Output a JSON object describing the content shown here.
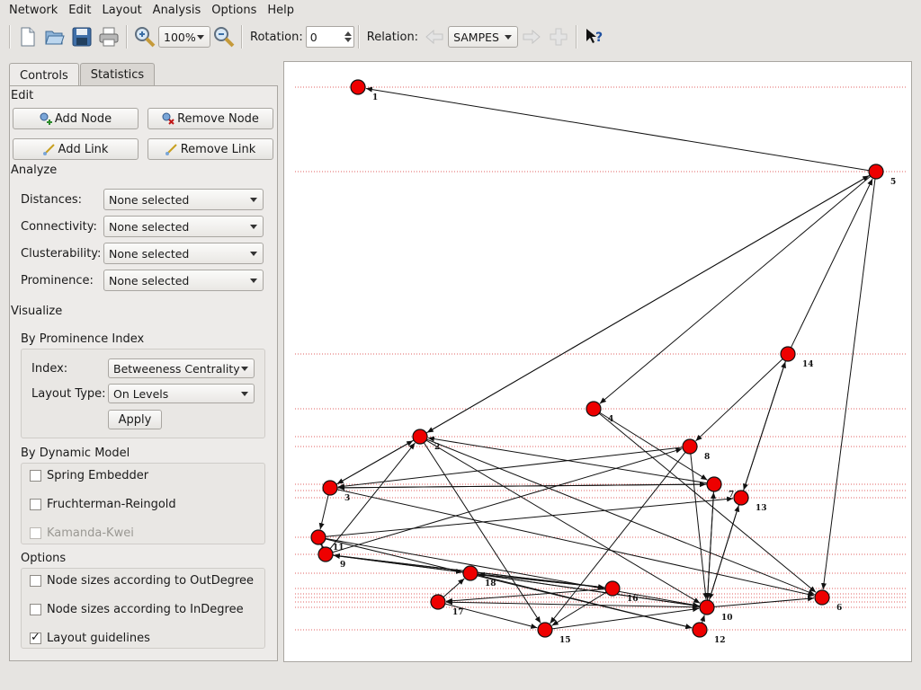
{
  "menubar": {
    "items": [
      "Network",
      "Edit",
      "Layout",
      "Analysis",
      "Options",
      "Help"
    ]
  },
  "toolbar": {
    "zoom": "100%",
    "rotation_label": "Rotation:",
    "rotation_value": "0",
    "relation_label": "Relation:",
    "relation_value": "SAMPES",
    "icons": [
      "new-file-icon",
      "open-folder-icon",
      "save-icon",
      "print-icon",
      "zoom-in-icon",
      "zoom-out-icon",
      "previous-relation-icon",
      "next-relation-icon",
      "add-relation-icon",
      "whats-this-help-icon"
    ]
  },
  "tabs": [
    "Controls",
    "Statistics"
  ],
  "edit": {
    "title": "Edit",
    "add_node": "Add Node",
    "remove_node": "Remove Node",
    "add_link": "Add Link",
    "remove_link": "Remove Link"
  },
  "analyze": {
    "title": "Analyze",
    "rows": [
      {
        "label": "Distances:",
        "value": "None selected"
      },
      {
        "label": "Connectivity:",
        "value": "None selected"
      },
      {
        "label": "Clusterability:",
        "value": "None selected"
      },
      {
        "label": "Prominence:",
        "value": "None selected"
      }
    ]
  },
  "visualize": {
    "title": "Visualize",
    "prominence": {
      "title": "By Prominence Index",
      "index_label": "Index:",
      "index_value": "Betweeness Centrality",
      "layout_label": "Layout Type:",
      "layout_value": "On Levels",
      "apply": "Apply"
    },
    "dynamic": {
      "title": "By Dynamic Model",
      "spring": "Spring Embedder",
      "fruchterman": "Fruchterman-Reingold",
      "kamada": "Kamanda-Kwei"
    },
    "options": {
      "title": "Options",
      "outdegree": "Node sizes according to OutDegree",
      "indegree": "Node sizes according to InDegree",
      "guidelines": "Layout guidelines",
      "outdegree_checked": false,
      "indegree_checked": false,
      "guidelines_checked": true
    }
  },
  "graph": {
    "node_color": "#ee0000",
    "guideline_color": "#e06060",
    "nodes": [
      {
        "id": "1"
      },
      {
        "id": "2"
      },
      {
        "id": "3"
      },
      {
        "id": "4"
      },
      {
        "id": "5"
      },
      {
        "id": "6"
      },
      {
        "id": "7"
      },
      {
        "id": "8"
      },
      {
        "id": "9"
      },
      {
        "id": "10"
      },
      {
        "id": "11"
      },
      {
        "id": "12"
      },
      {
        "id": "13"
      },
      {
        "id": "14"
      },
      {
        "id": "15"
      },
      {
        "id": "16"
      },
      {
        "id": "17"
      },
      {
        "id": "18"
      }
    ],
    "edges": [
      [
        "5",
        "1"
      ],
      [
        "2",
        "5"
      ],
      [
        "5",
        "2"
      ],
      [
        "5",
        "4"
      ],
      [
        "5",
        "6"
      ],
      [
        "14",
        "5"
      ],
      [
        "3",
        "2"
      ],
      [
        "2",
        "3"
      ],
      [
        "3",
        "7"
      ],
      [
        "7",
        "3"
      ],
      [
        "3",
        "6"
      ],
      [
        "3",
        "11"
      ],
      [
        "9",
        "2"
      ],
      [
        "7",
        "2"
      ],
      [
        "2",
        "6"
      ],
      [
        "2",
        "10"
      ],
      [
        "2",
        "15"
      ],
      [
        "4",
        "6"
      ],
      [
        "4",
        "7"
      ],
      [
        "9",
        "8"
      ],
      [
        "8",
        "3"
      ],
      [
        "8",
        "10"
      ],
      [
        "11",
        "13"
      ],
      [
        "14",
        "8"
      ],
      [
        "14",
        "13"
      ],
      [
        "13",
        "14"
      ],
      [
        "7",
        "10"
      ],
      [
        "10",
        "7"
      ],
      [
        "10",
        "13"
      ],
      [
        "13",
        "10"
      ],
      [
        "18",
        "9"
      ],
      [
        "9",
        "18"
      ],
      [
        "16",
        "9"
      ],
      [
        "9",
        "16"
      ],
      [
        "18",
        "16"
      ],
      [
        "16",
        "18"
      ],
      [
        "18",
        "10"
      ],
      [
        "10",
        "18"
      ],
      [
        "18",
        "12"
      ],
      [
        "11",
        "12"
      ],
      [
        "16",
        "17"
      ],
      [
        "17",
        "18"
      ],
      [
        "17",
        "15"
      ],
      [
        "16",
        "15"
      ],
      [
        "15",
        "10"
      ],
      [
        "10",
        "17"
      ],
      [
        "11",
        "9"
      ],
      [
        "9",
        "11"
      ],
      [
        "12",
        "10"
      ],
      [
        "10",
        "6"
      ],
      [
        "8",
        "15"
      ],
      [
        "11",
        "10"
      ]
    ]
  }
}
